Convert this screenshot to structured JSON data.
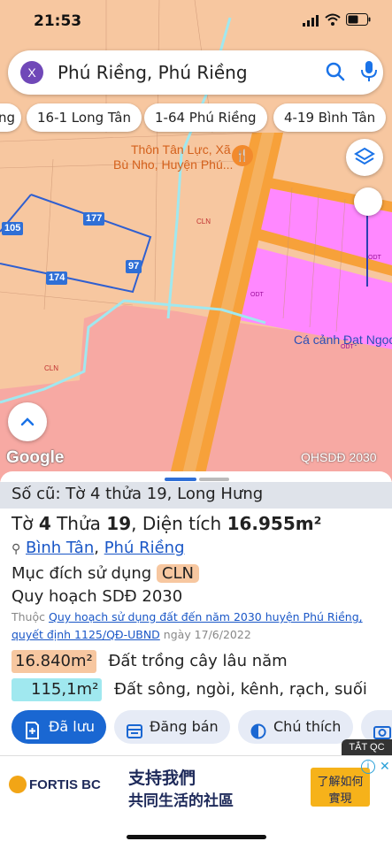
{
  "status": {
    "time": "21:53"
  },
  "search": {
    "close_label": "X",
    "query": "Phú Riềng, Phú Riềng"
  },
  "chips": [
    "ng",
    "16-1 Long Tân",
    "1-64 Phú Riềng",
    "4-19 Bình Tân"
  ],
  "map": {
    "place_name_line1": "Thôn Tân Lực, Xã",
    "place_name_line2": "Bù Nho, Huyện Phú...",
    "zone_labels": [
      "CLN",
      "CLN",
      "ODT",
      "ODT",
      "ODT"
    ],
    "parcel_numbers": [
      "105",
      "177",
      "174",
      "97"
    ],
    "overlay_label": "Cá cảnh Đạt Ngọc",
    "logo": "Google",
    "source": "QHSDĐ 2030",
    "colors": {
      "cln": "#f7c7a0",
      "odt": "#ff88ff",
      "road": "#f7a13a",
      "pink_zone": "#f7a9a3",
      "canal": "#a0e8ef"
    }
  },
  "sheet": {
    "old_info": "Số cũ: Tờ 4 thửa 19, Long Hưng",
    "title_prefix": "Tờ",
    "sheet_no": "4",
    "title_mid": "Thửa",
    "plot_no": "19",
    "area_prefix": ", Diện tích",
    "area_value": "16.955m²",
    "location_1": "Bình Tân",
    "location_sep": ", ",
    "location_2": "Phú Riềng",
    "purpose_label": "Mục đích sử dụng",
    "purpose_code": "CLN",
    "plan_label": "Quy hoạch SDĐ 2030",
    "note_prefix": "Thuộc",
    "note_link": "Quy hoạch sử dụng đất đến năm 2030 huyện Phú Riềng,",
    "note_link2": "quyết định 1125/QĐ-UBND",
    "note_date": "ngày 17/6/2022",
    "areas": [
      {
        "value": "16.840m²",
        "label": "Đất trồng cây lâu năm",
        "color": "#f7c7a0"
      },
      {
        "value": "115,1m²",
        "label": "Đất sông, ngòi, kênh, rạch, suối",
        "color": "#a0e8ef"
      }
    ]
  },
  "actions": {
    "saved": "Đã lưu",
    "post_sale": "Đăng bán",
    "note": "Chú thích"
  },
  "ad": {
    "tag": "TẮT QC",
    "brand": "FORTIS BC",
    "tagline_1": "支持我們",
    "tagline_2": "共同生活的社區",
    "cta_1": "了解如何",
    "cta_2": "實現"
  }
}
